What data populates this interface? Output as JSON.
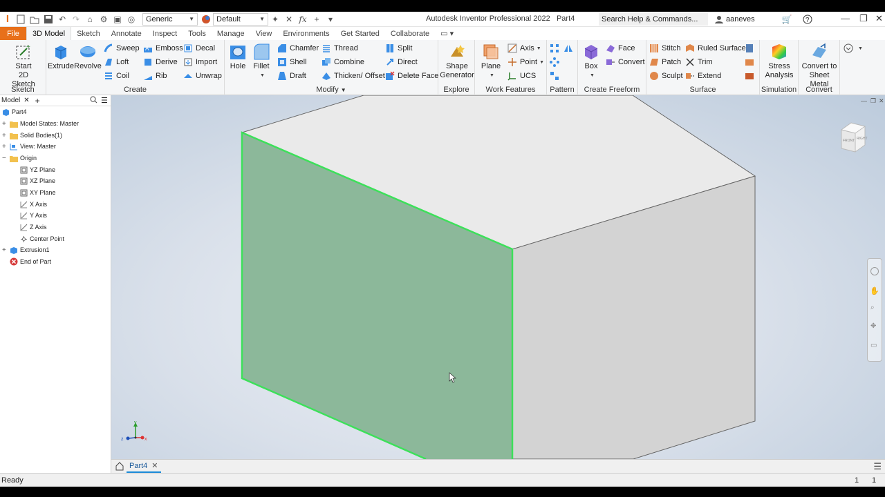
{
  "titlebar": {
    "appearance_combo": "Generic",
    "style_combo": "Default",
    "app_title": "Autodesk Inventor Professional 2022",
    "doc_title": "Part4",
    "search_placeholder": "Search Help & Commands...",
    "username": "aaneves"
  },
  "tabs": [
    "File",
    "3D Model",
    "Sketch",
    "Annotate",
    "Inspect",
    "Tools",
    "Manage",
    "View",
    "Environments",
    "Get Started",
    "Collaborate"
  ],
  "ribbon": {
    "sketch": {
      "title": "Sketch",
      "start": "Start",
      "start2": "2D Sketch"
    },
    "create": {
      "title": "Create",
      "extrude": "Extrude",
      "revolve": "Revolve",
      "sweep": "Sweep",
      "loft": "Loft",
      "coil": "Coil",
      "emboss": "Emboss",
      "derive": "Derive",
      "rib": "Rib",
      "decal": "Decal",
      "import": "Import",
      "unwrap": "Unwrap"
    },
    "modify": {
      "title": "Modify",
      "hole": "Hole",
      "fillet": "Fillet",
      "chamfer": "Chamfer",
      "shell": "Shell",
      "draft": "Draft",
      "thread": "Thread",
      "combine": "Combine",
      "thicken": "Thicken/ Offset",
      "split": "Split",
      "direct": "Direct",
      "delete_face": "Delete Face"
    },
    "explore": {
      "title": "Explore",
      "shape": "Shape",
      "generator": "Generator"
    },
    "work_features": {
      "title": "Work Features",
      "plane": "Plane",
      "axis": "Axis",
      "point": "Point",
      "ucs": "UCS"
    },
    "pattern": {
      "title": "Pattern"
    },
    "freeform": {
      "title": "Create Freeform",
      "box": "Box",
      "face": "Face",
      "convert": "Convert"
    },
    "surface": {
      "title": "Surface",
      "stitch": "Stitch",
      "patch": "Patch",
      "sculpt": "Sculpt",
      "ruled": "Ruled Surface",
      "trim": "Trim",
      "extend": "Extend"
    },
    "simulation": {
      "title": "Simulation",
      "stress": "Stress",
      "analysis": "Analysis"
    },
    "convert": {
      "title": "Convert",
      "line1": "Convert to",
      "line2": "Sheet Metal"
    }
  },
  "browser": {
    "tab_label": "Model",
    "tree": [
      {
        "label": "Part4",
        "icon": "part-icon"
      },
      {
        "label": "Model States: Master",
        "icon": "folder-icon"
      },
      {
        "label": "Solid Bodies(1)",
        "icon": "folder-icon"
      },
      {
        "label": "View: Master",
        "icon": "view-icon"
      },
      {
        "label": "Origin",
        "icon": "folder-icon"
      },
      {
        "label": "YZ Plane",
        "icon": "plane-icon"
      },
      {
        "label": "XZ Plane",
        "icon": "plane-icon"
      },
      {
        "label": "XY Plane",
        "icon": "plane-icon"
      },
      {
        "label": "X Axis",
        "icon": "axis-icon"
      },
      {
        "label": "Y Axis",
        "icon": "axis-icon"
      },
      {
        "label": "Z Axis",
        "icon": "axis-icon"
      },
      {
        "label": "Center Point",
        "icon": "point-icon"
      },
      {
        "label": "Extrusion1",
        "icon": "extrusion-icon"
      },
      {
        "label": "End of Part",
        "icon": "end-of-part-icon"
      }
    ]
  },
  "viewcube": {
    "face1": "FRONT",
    "face2": "RIGHT"
  },
  "doc_tab": "Part4",
  "status": {
    "text": "Ready",
    "count1": "1",
    "count2": "1"
  },
  "colors": {
    "accent": "#e8701a",
    "selection": "#3de05a",
    "selected_face": "#8cb89a"
  }
}
